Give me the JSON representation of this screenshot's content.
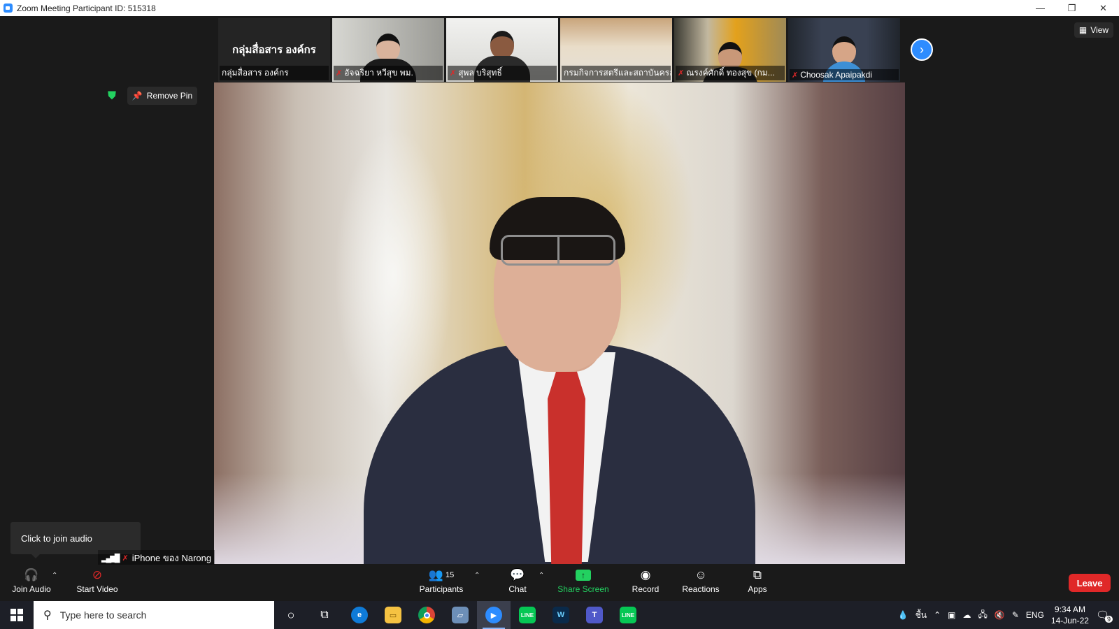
{
  "window": {
    "title": "Zoom Meeting Participant ID: 515318",
    "controls": [
      "—",
      "❐",
      "✕"
    ]
  },
  "filmstrip": {
    "name_card": {
      "big_text": "กลุ่มสื่อสาร องค์กร",
      "label": "กลุ่มสื่อสาร องค์กร"
    },
    "tiles": [
      {
        "name": "อัจฉริยา หวีสุข พม."
      },
      {
        "name": "สุพล บริสุทธิ์"
      },
      {
        "name": "กรมกิจการสตรีและสถาบันครอ..."
      },
      {
        "name": "ณรงค์ศักดิ์ ทองสุข (กม..."
      },
      {
        "name": "Choosak Apaipakdi"
      }
    ],
    "next_icon": "chevron-right"
  },
  "view_button": {
    "label": "View"
  },
  "remove_pin": {
    "label": "Remove Pin"
  },
  "audio_tooltip": {
    "text": "Click to join audio"
  },
  "self_view": {
    "name": "iPhone ของ Narong"
  },
  "toolbar": {
    "join_audio": "Join Audio",
    "start_video": "Start Video",
    "participants": "Participants",
    "participants_count": "15",
    "chat": "Chat",
    "share_screen": "Share Screen",
    "record": "Record",
    "reactions": "Reactions",
    "apps": "Apps",
    "leave": "Leave"
  },
  "taskbar": {
    "search_placeholder": "Type here to search",
    "tray_temp": "ชื้น",
    "language": "ENG",
    "time": "9:34 AM",
    "date": "14-Jun-22",
    "notification_count": "9"
  },
  "colors": {
    "accent": "#2d8cff",
    "share": "#23d160",
    "leave": "#e02828",
    "muted": "#e02828"
  }
}
